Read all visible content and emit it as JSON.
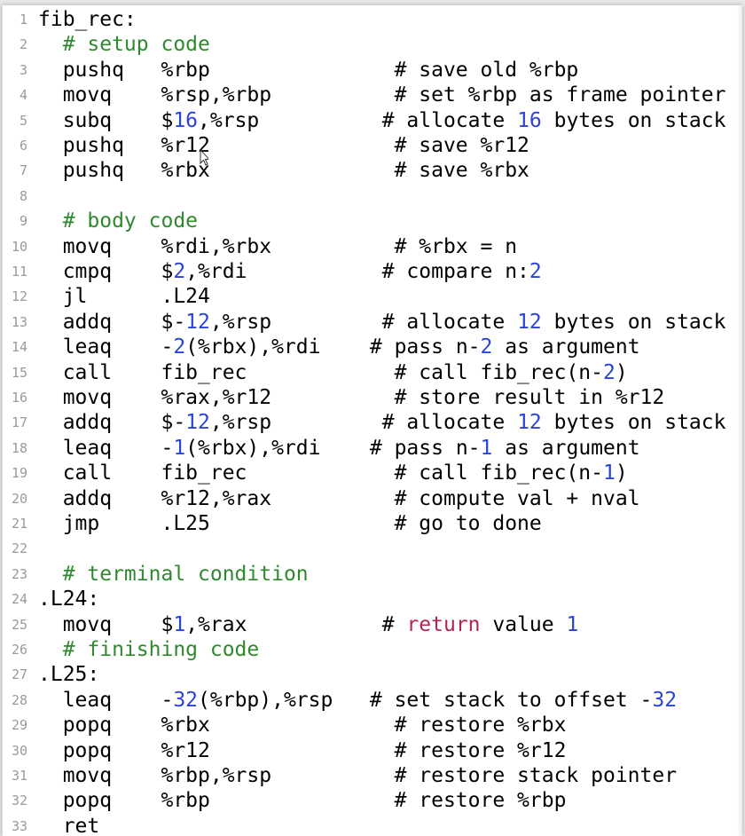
{
  "editor": {
    "lines": [
      {
        "n": "1",
        "segs": [
          {
            "t": "fib_rec:",
            "c": ""
          }
        ]
      },
      {
        "n": "2",
        "segs": [
          {
            "t": "  # setup code",
            "c": "comment"
          }
        ]
      },
      {
        "n": "3",
        "segs": [
          {
            "t": "  pushq   %rbp               # save old %rbp",
            "c": ""
          }
        ]
      },
      {
        "n": "4",
        "segs": [
          {
            "t": "  movq    %rsp,%rbp          # set %rbp as frame pointer",
            "c": ""
          }
        ]
      },
      {
        "n": "5",
        "segs": [
          {
            "t": "  subq    $",
            "c": ""
          },
          {
            "t": "16",
            "c": "num"
          },
          {
            "t": ",%rsp          # allocate ",
            "c": ""
          },
          {
            "t": "16",
            "c": "num"
          },
          {
            "t": " bytes on stack",
            "c": ""
          }
        ]
      },
      {
        "n": "6",
        "segs": [
          {
            "t": "  pushq   %r12               # save %r12",
            "c": ""
          }
        ]
      },
      {
        "n": "7",
        "segs": [
          {
            "t": "  pushq   %rbx               # save %rbx",
            "c": ""
          }
        ]
      },
      {
        "n": "8",
        "segs": [
          {
            "t": "",
            "c": ""
          }
        ]
      },
      {
        "n": "9",
        "segs": [
          {
            "t": "  # body code",
            "c": "comment"
          }
        ]
      },
      {
        "n": "10",
        "segs": [
          {
            "t": "  movq    %rdi,%rbx          # %rbx = n",
            "c": ""
          }
        ]
      },
      {
        "n": "11",
        "segs": [
          {
            "t": "  cmpq    $",
            "c": ""
          },
          {
            "t": "2",
            "c": "num"
          },
          {
            "t": ",%rdi           # compare n:",
            "c": ""
          },
          {
            "t": "2",
            "c": "num"
          }
        ]
      },
      {
        "n": "12",
        "segs": [
          {
            "t": "  jl      .L24",
            "c": ""
          }
        ]
      },
      {
        "n": "13",
        "segs": [
          {
            "t": "  addq    $-",
            "c": ""
          },
          {
            "t": "12",
            "c": "num"
          },
          {
            "t": ",%rsp         # allocate ",
            "c": ""
          },
          {
            "t": "12",
            "c": "num"
          },
          {
            "t": " bytes on stack",
            "c": ""
          }
        ]
      },
      {
        "n": "14",
        "segs": [
          {
            "t": "  leaq    -",
            "c": ""
          },
          {
            "t": "2",
            "c": "num"
          },
          {
            "t": "(%rbx),%rdi    # pass n-",
            "c": ""
          },
          {
            "t": "2",
            "c": "num"
          },
          {
            "t": " as argument",
            "c": ""
          }
        ]
      },
      {
        "n": "15",
        "segs": [
          {
            "t": "  call    fib_rec            # call fib_rec(n-",
            "c": ""
          },
          {
            "t": "2",
            "c": "num"
          },
          {
            "t": ")",
            "c": ""
          }
        ]
      },
      {
        "n": "16",
        "segs": [
          {
            "t": "  movq    %rax,%r12          # store result in %r12",
            "c": ""
          }
        ]
      },
      {
        "n": "17",
        "segs": [
          {
            "t": "  addq    $-",
            "c": ""
          },
          {
            "t": "12",
            "c": "num"
          },
          {
            "t": ",%rsp         # allocate ",
            "c": ""
          },
          {
            "t": "12",
            "c": "num"
          },
          {
            "t": " bytes on stack",
            "c": ""
          }
        ]
      },
      {
        "n": "18",
        "segs": [
          {
            "t": "  leaq    -",
            "c": ""
          },
          {
            "t": "1",
            "c": "num"
          },
          {
            "t": "(%rbx),%rdi    # pass n-",
            "c": ""
          },
          {
            "t": "1",
            "c": "num"
          },
          {
            "t": " as argument",
            "c": ""
          }
        ]
      },
      {
        "n": "19",
        "segs": [
          {
            "t": "  call    fib_rec            # call fib_rec(n-",
            "c": ""
          },
          {
            "t": "1",
            "c": "num"
          },
          {
            "t": ")",
            "c": ""
          }
        ]
      },
      {
        "n": "20",
        "segs": [
          {
            "t": "  addq    %r12,%rax          # compute val + nval",
            "c": ""
          }
        ]
      },
      {
        "n": "21",
        "segs": [
          {
            "t": "  jmp     .L25               # go to done",
            "c": ""
          }
        ]
      },
      {
        "n": "22",
        "segs": [
          {
            "t": "",
            "c": ""
          }
        ]
      },
      {
        "n": "23",
        "segs": [
          {
            "t": "  # terminal condition",
            "c": "comment"
          }
        ]
      },
      {
        "n": "24",
        "segs": [
          {
            "t": ".L24:",
            "c": ""
          }
        ]
      },
      {
        "n": "25",
        "segs": [
          {
            "t": "  movq    $",
            "c": ""
          },
          {
            "t": "1",
            "c": "num"
          },
          {
            "t": ",%rax           # ",
            "c": ""
          },
          {
            "t": "return",
            "c": "kw"
          },
          {
            "t": " value ",
            "c": ""
          },
          {
            "t": "1",
            "c": "num"
          }
        ]
      },
      {
        "n": "26",
        "segs": [
          {
            "t": "  # finishing code",
            "c": "comment"
          }
        ]
      },
      {
        "n": "27",
        "segs": [
          {
            "t": ".L25:",
            "c": ""
          }
        ]
      },
      {
        "n": "28",
        "segs": [
          {
            "t": "  leaq    -",
            "c": ""
          },
          {
            "t": "32",
            "c": "num"
          },
          {
            "t": "(%rbp),%rsp   # set stack to offset -",
            "c": ""
          },
          {
            "t": "32",
            "c": "num"
          }
        ]
      },
      {
        "n": "29",
        "segs": [
          {
            "t": "  popq    %rbx               # restore %rbx",
            "c": ""
          }
        ]
      },
      {
        "n": "30",
        "segs": [
          {
            "t": "  popq    %r12               # restore %r12",
            "c": ""
          }
        ]
      },
      {
        "n": "31",
        "segs": [
          {
            "t": "  movq    %rbp,%rsp          # restore stack pointer",
            "c": ""
          }
        ]
      },
      {
        "n": "32",
        "segs": [
          {
            "t": "  popq    %rbp               # restore %rbp",
            "c": ""
          }
        ]
      },
      {
        "n": "33",
        "segs": [
          {
            "t": "  ret",
            "c": ""
          }
        ]
      }
    ]
  },
  "cursor": {
    "icon": "text-cursor-icon"
  },
  "colors": {
    "comment": "#2f8a2f",
    "number": "#2a44d8",
    "keyword": "#b0245a",
    "line_number": "#9a9a9a"
  }
}
